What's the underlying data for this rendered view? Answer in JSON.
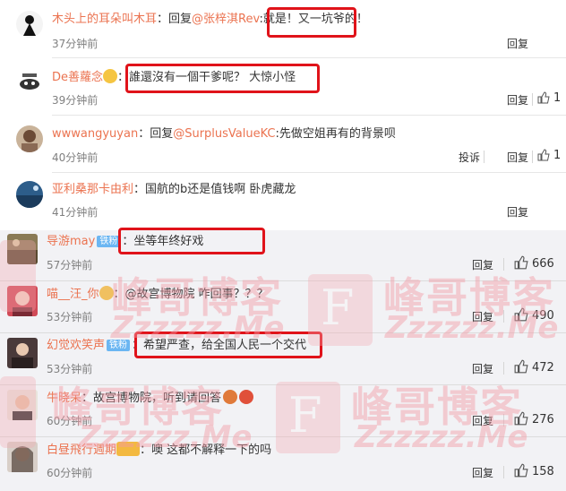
{
  "comments_top": [
    {
      "name": "木头上的耳朵叫木耳",
      "reply_prefix": "：回复",
      "mention": "@张梓淇Rev",
      "text_before": ":就是！",
      "highlight": "又一坑爷的！",
      "time": "37分钟前",
      "actions": [
        "回复"
      ],
      "likes": ""
    },
    {
      "name": "De善蘿念",
      "reply_prefix": "：",
      "mention": "",
      "text_before": "",
      "highlight": "誰還沒有一個干爹呢？ 大惊小怪",
      "time": "39分钟前",
      "actions": [
        "回复"
      ],
      "likes": "1"
    },
    {
      "name": "wwwangyuyan",
      "reply_prefix": "：回复",
      "mention": "@SurplusValueKC",
      "text_before": ":先做空姐再有的背景呗",
      "highlight": "",
      "time": "40分钟前",
      "actions": [
        "投诉",
        "回复"
      ],
      "likes": "1"
    },
    {
      "name": "亚利桑那卡由利",
      "reply_prefix": "：",
      "mention": "",
      "text_before": "国航的b还是值钱啊 卧虎藏龙",
      "highlight": "",
      "time": "41分钟前",
      "actions": [
        "回复"
      ],
      "likes": ""
    }
  ],
  "comments_bottom": [
    {
      "name": "导游may",
      "badge": "铁粉",
      "text": "坐等年终好戏",
      "time": "57分钟前",
      "reply_label": "回复",
      "likes": "666"
    },
    {
      "name": "喵__汪_你",
      "badge": "",
      "text": "@故宫博物院 咋回事？？？",
      "time": "53分钟前",
      "reply_label": "回复",
      "likes": "490"
    },
    {
      "name": "幻觉欢笑声",
      "badge": "铁粉",
      "text": "希望严查，给全国人民一个交代",
      "time": "53分钟前",
      "reply_label": "回复",
      "likes": "472"
    },
    {
      "name": "牛晓呆",
      "badge": "",
      "text": "故宫博物院，听到请回答",
      "time": "60分钟前",
      "reply_label": "回复",
      "likes": "276"
    },
    {
      "name": "白昼飛行週期",
      "badge": "",
      "text": "噢 这都不解释一下的吗",
      "time": "60分钟前",
      "reply_label": "回复",
      "likes": "158"
    }
  ],
  "watermark": {
    "brand": "峰哥博客",
    "url": "Zzzzzz.Me",
    "letter": "F"
  },
  "colors": {
    "name": "#eb7350",
    "highlight_box": "#e0131a",
    "badge": "#6bb6f2"
  }
}
